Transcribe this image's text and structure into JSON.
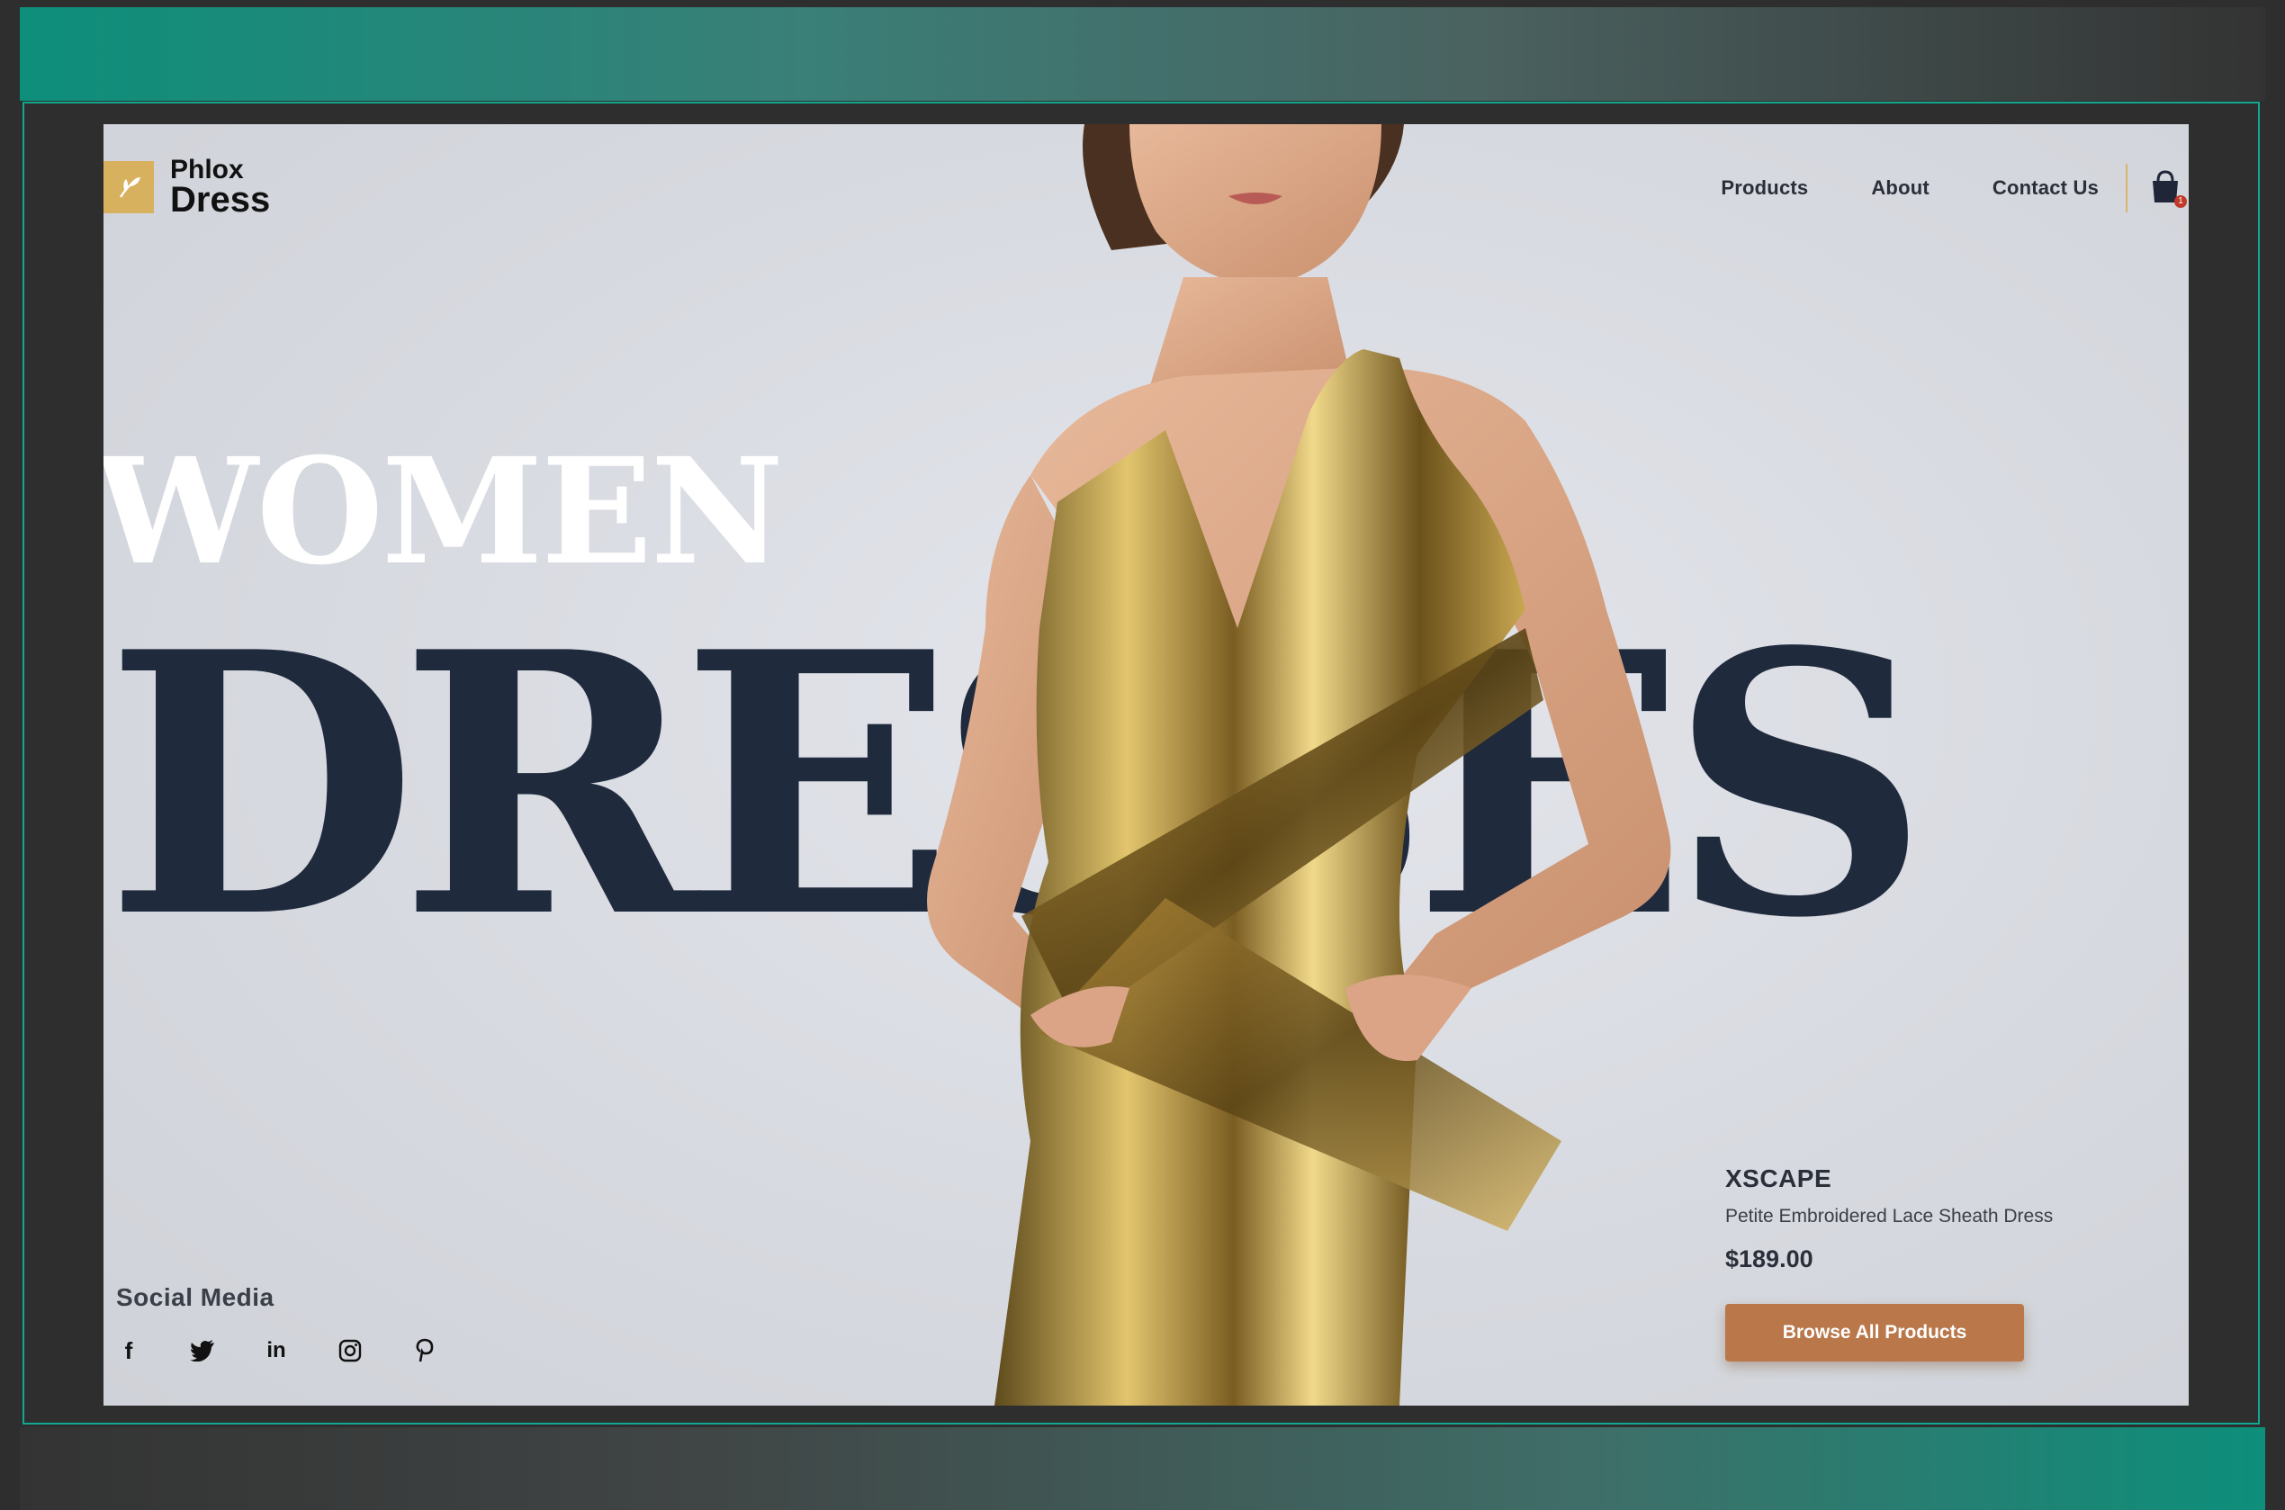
{
  "brand": {
    "line1": "Phlox",
    "line2": "Dress",
    "accent": "#d8b15e"
  },
  "nav": {
    "items": [
      "Products",
      "About",
      "Contact Us"
    ],
    "cart_count": "1",
    "cart_icon": "shopping-bag-icon"
  },
  "hero": {
    "line1": "WOMEN",
    "line2": "DRESSES"
  },
  "product": {
    "brand": "XSCAPE",
    "name": "Petite Embroidered Lace Sheath Dress",
    "price": "$189.00",
    "cta": "Browse All Products",
    "cta_color": "#b9774a"
  },
  "social": {
    "title": "Social Media",
    "icons": [
      "facebook-icon",
      "twitter-icon",
      "linkedin-icon",
      "instagram-icon",
      "pinterest-icon"
    ]
  },
  "colors": {
    "frame": "#11a88f",
    "headline_dark": "#202a3d",
    "background": "#2e2e2e"
  }
}
